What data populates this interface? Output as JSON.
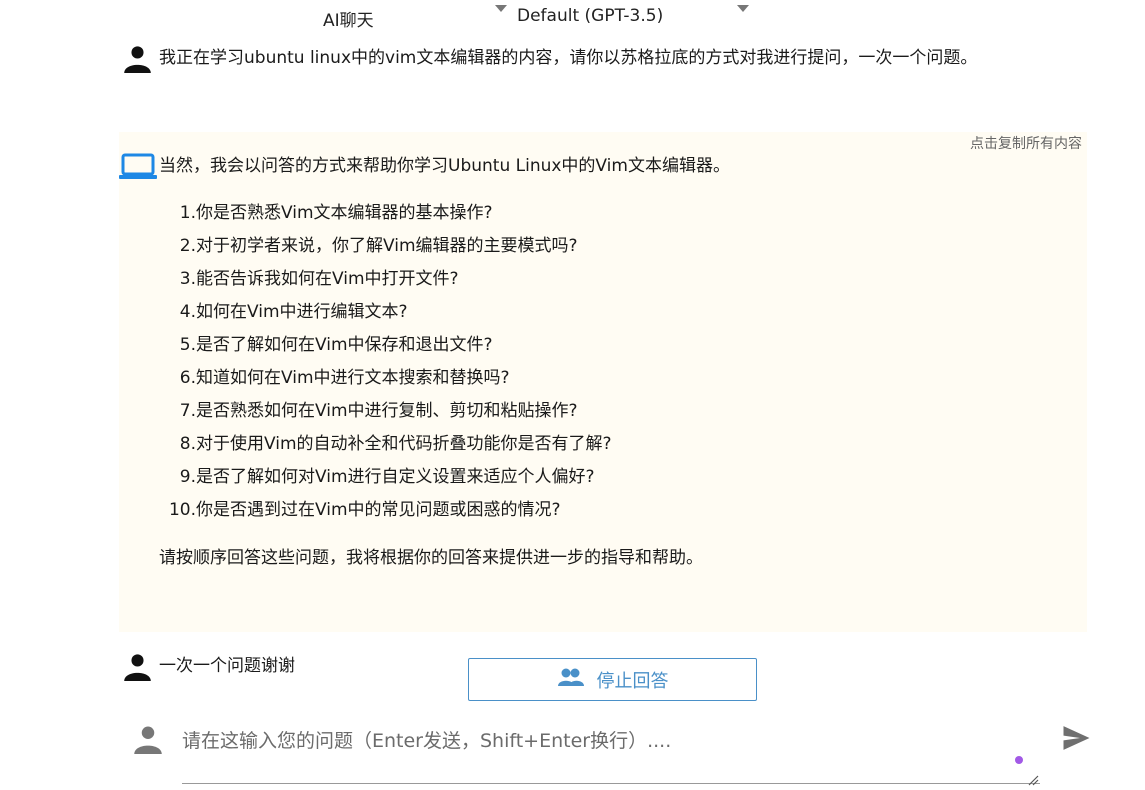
{
  "top_bar": {
    "mode_select_value": "AI聊天",
    "model_select_value": "Default (GPT-3.5)"
  },
  "conversation": {
    "user_message_1": "我正在学习ubuntu linux中的vim文本编辑器的内容，请你以苏格拉底的方式对我进行提问，一次一个问题。",
    "assistant": {
      "copy_all_label": "点击复制所有内容",
      "intro": "当然，我会以问答的方式来帮助你学习Ubuntu Linux中的Vim文本编辑器。",
      "questions": [
        {
          "num": "1.",
          "text": "你是否熟悉Vim文本编辑器的基本操作?"
        },
        {
          "num": "2.",
          "text": "对于初学者来说，你了解Vim编辑器的主要模式吗?"
        },
        {
          "num": "3.",
          "text": "能否告诉我如何在Vim中打开文件?"
        },
        {
          "num": "4.",
          "text": "如何在Vim中进行编辑文本?"
        },
        {
          "num": "5.",
          "text": "是否了解如何在Vim中保存和退出文件?"
        },
        {
          "num": "6.",
          "text": "知道如何在Vim中进行文本搜索和替换吗?"
        },
        {
          "num": "7.",
          "text": "是否熟悉如何在Vim中进行复制、剪切和粘贴操作?"
        },
        {
          "num": "8.",
          "text": "对于使用Vim的自动补全和代码折叠功能你是否有了解?"
        },
        {
          "num": "9.",
          "text": "是否了解如何对Vim进行自定义设置来适应个人偏好?"
        },
        {
          "num": "10.",
          "text": "你是否遇到过在Vim中的常见问题或困惑的情况?"
        }
      ],
      "closing": "请按顺序回答这些问题，我将根据你的回答来提供进一步的指导和帮助。"
    },
    "user_message_2": "一次一个问题谢谢"
  },
  "stop_button": {
    "label": "停止回答"
  },
  "input": {
    "placeholder": "请在这输入您的问题（Enter发送，Shift+Enter换行）...."
  },
  "colors": {
    "accent": "#4a90c8",
    "assistant_bg": "#fffcf3",
    "laptop_icon": "#1e88e5",
    "dot": "#a259e6"
  },
  "icons": {
    "user": "person-icon",
    "assistant": "laptop-icon",
    "stop": "people-icon",
    "send": "send-icon"
  }
}
